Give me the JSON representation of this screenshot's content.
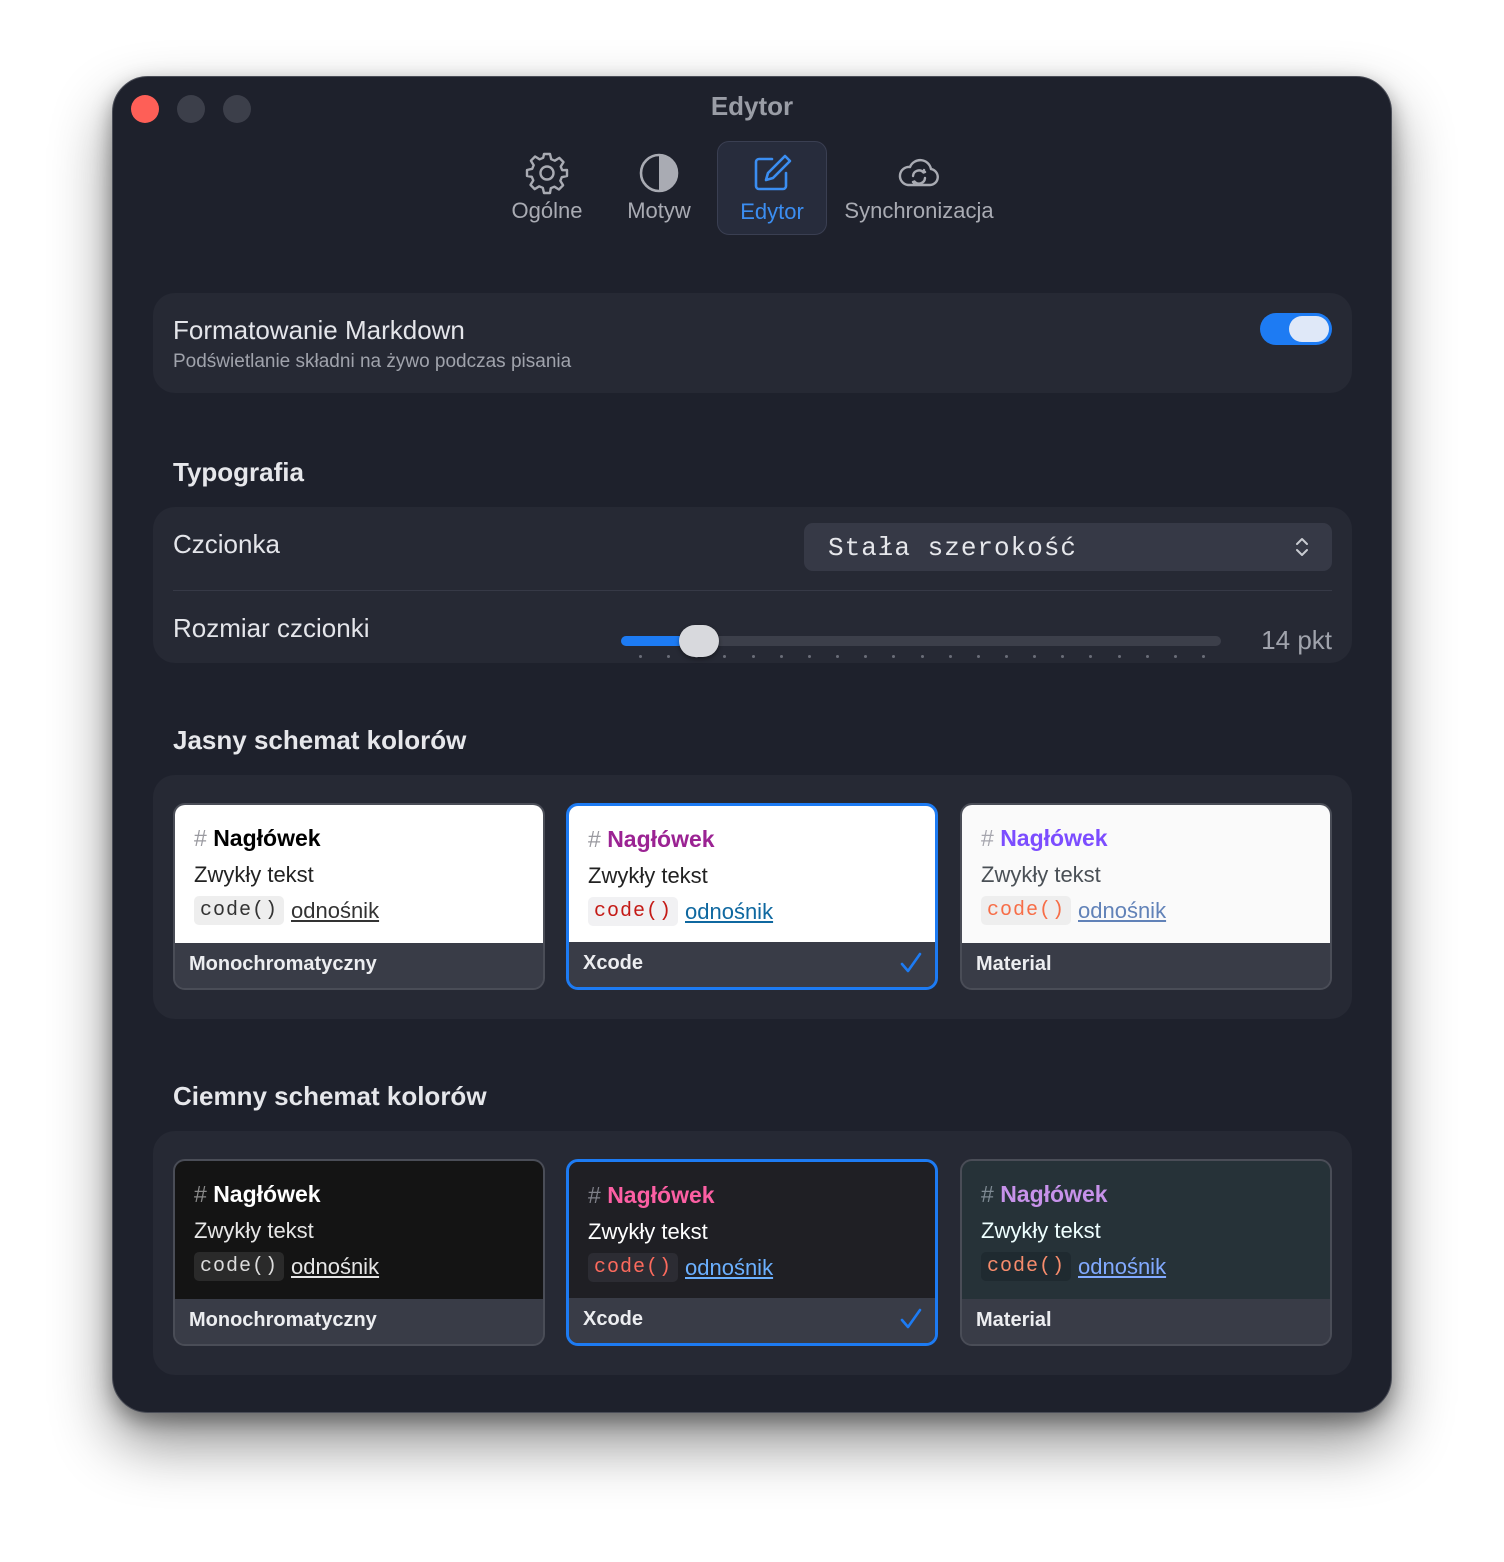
{
  "window": {
    "title": "Edytor"
  },
  "tabs": [
    {
      "label": "Ogólne",
      "icon": "gear-icon"
    },
    {
      "label": "Motyw",
      "icon": "half-circle-icon"
    },
    {
      "label": "Edytor",
      "icon": "edit-icon",
      "active": true
    },
    {
      "label": "Synchronizacja",
      "icon": "cloud-sync-icon"
    }
  ],
  "markdown": {
    "title": "Formatowanie Markdown",
    "subtitle": "Podświetlanie składni na żywo podczas pisania",
    "enabled": true
  },
  "typography": {
    "section_title": "Typografia",
    "font_label": "Czcionka",
    "font_value": "Stała szerokość",
    "size_label": "Rozmiar czcionki",
    "size_value": "14 pkt",
    "size_fraction": 0.13
  },
  "light_schemes": {
    "section_title": "Jasny schemat kolorów",
    "selected": "Xcode",
    "items": [
      {
        "name": "Monochromatyczny",
        "hash": "#",
        "heading": "Nagłówek",
        "text": "Zwykły tekst",
        "code": "code()",
        "link": "odnośnik",
        "colors": {
          "bg": "#ffffff",
          "hash": "#9a9aa0",
          "heading": "#000000",
          "text": "#222222",
          "code": "#333333",
          "code_bg": "#eeeeee",
          "link": "#333333"
        }
      },
      {
        "name": "Xcode",
        "hash": "#",
        "heading": "Nagłówek",
        "text": "Zwykły tekst",
        "code": "code()",
        "link": "odnośnik",
        "colors": {
          "bg": "#ffffff",
          "hash": "#9a9aa0",
          "heading": "#9b2393",
          "text": "#222222",
          "code": "#c41a16",
          "code_bg": "#f1f1f3",
          "link": "#0f68a0"
        }
      },
      {
        "name": "Material",
        "hash": "#",
        "heading": "Nagłówek",
        "text": "Zwykły tekst",
        "code": "code()",
        "link": "odnośnik",
        "colors": {
          "bg": "#fafafa",
          "hash": "#a6a6ae",
          "heading": "#7c4dff",
          "text": "#4a5056",
          "code": "#f76d47",
          "code_bg": "#eeeeee",
          "link": "#6182b8"
        }
      }
    ]
  },
  "dark_schemes": {
    "section_title": "Ciemny schemat kolorów",
    "selected": "Xcode",
    "items": [
      {
        "name": "Monochromatyczny",
        "hash": "#",
        "heading": "Nagłówek",
        "text": "Zwykły tekst",
        "code": "code()",
        "link": "odnośnik",
        "colors": {
          "bg": "#141414",
          "hash": "#8a8a8a",
          "heading": "#ffffff",
          "text": "#e6e6e6",
          "code": "#dcdcdc",
          "code_bg": "#2a2a2a",
          "link": "#e6e6e6"
        }
      },
      {
        "name": "Xcode",
        "hash": "#",
        "heading": "Nagłówek",
        "text": "Zwykły tekst",
        "code": "code()",
        "link": "odnośnik",
        "colors": {
          "bg": "#1f1f24",
          "hash": "#7f8089",
          "heading": "#fc5fa3",
          "text": "#ffffff",
          "code": "#fc6a5d",
          "code_bg": "#2c2c33",
          "link": "#6bb0ff"
        }
      },
      {
        "name": "Material",
        "hash": "#",
        "heading": "Nagłówek",
        "text": "Zwykły tekst",
        "code": "code()",
        "link": "odnośnik",
        "colors": {
          "bg": "#263238",
          "hash": "#7e8a93",
          "heading": "#c792ea",
          "text": "#eeffff",
          "code": "#f78c6c",
          "code_bg": "#1f2a30",
          "link": "#82aaff"
        }
      }
    ]
  },
  "colors": {
    "accent": "#1d7bf3",
    "window_bg": "#1e212c",
    "card_bg": "#262934"
  }
}
